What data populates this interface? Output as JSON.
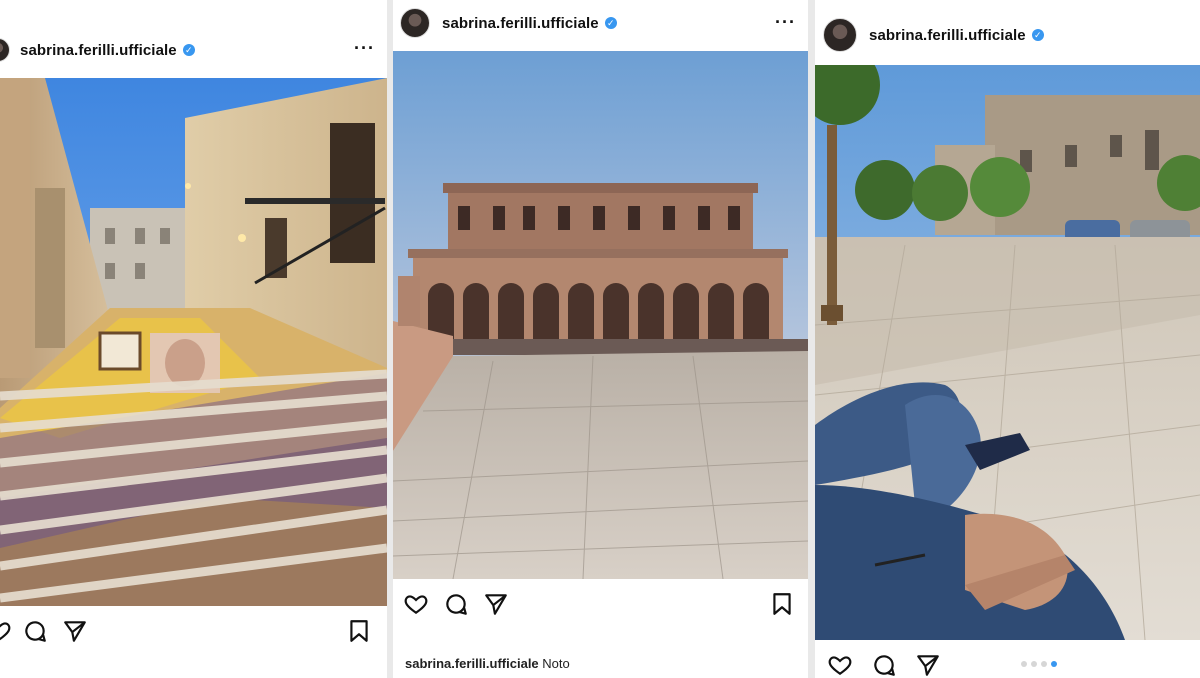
{
  "posts": [
    {
      "username": "sabrina.ferilli.ufficiale",
      "verified_symbol": "✓",
      "more_label": "···",
      "photo_subject": "stair-mosaic-street",
      "icons": [
        "heart-icon",
        "comment-icon",
        "share-icon",
        "bookmark-icon"
      ]
    },
    {
      "username": "sabrina.ferilli.ufficiale",
      "verified_symbol": "✓",
      "more_label": "···",
      "photo_subject": "baroque-palace-square",
      "icons": [
        "heart-icon",
        "comment-icon",
        "share-icon",
        "bookmark-icon"
      ],
      "caption_user": "sabrina.ferilli.ufficiale",
      "caption_text": "Noto"
    },
    {
      "username": "sabrina.ferilli.ufficiale",
      "verified_symbol": "✓",
      "photo_subject": "piazza-legs-in-jeans",
      "icons": [
        "heart-icon",
        "comment-icon",
        "share-icon"
      ],
      "carousel_pages": 4,
      "carousel_active": 4
    }
  ],
  "colors": {
    "verified": "#3897f0",
    "sky": "#4f8fe0",
    "stone": "#c8b08a",
    "paving": "#cfc7bd"
  }
}
